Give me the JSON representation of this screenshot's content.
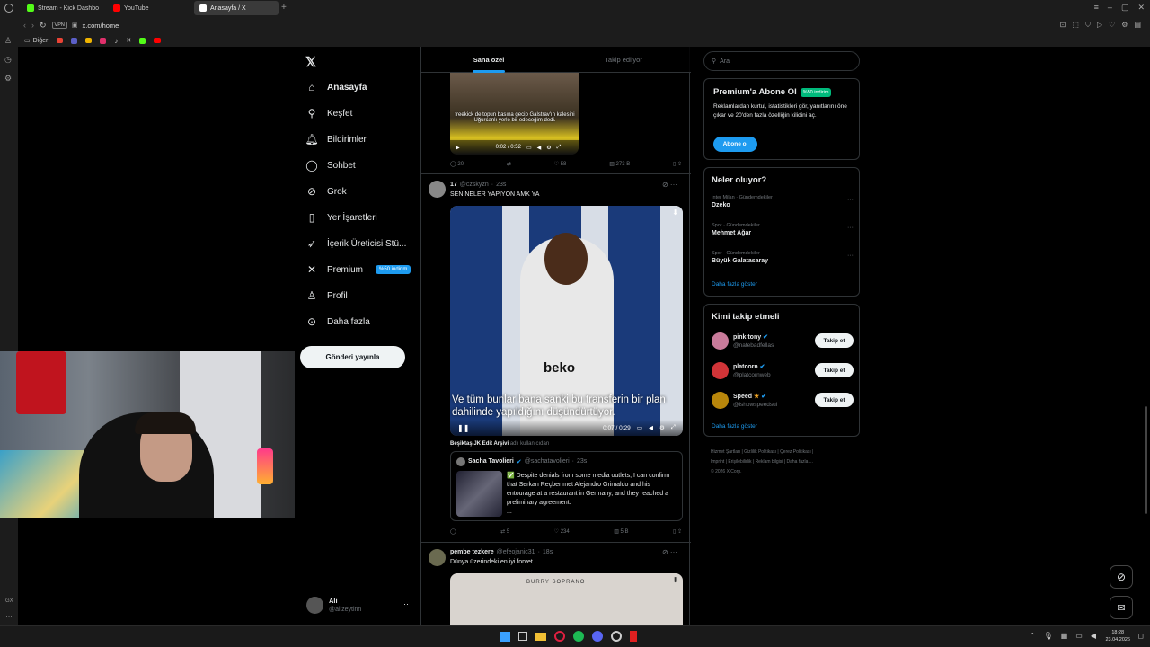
{
  "browser": {
    "tabs": [
      {
        "label": "Stream - Kick Dashbo",
        "color": "#53fc18"
      },
      {
        "label": "YouTube",
        "color": "#ff0000"
      },
      {
        "label": "Anasayfa / X",
        "color": "#ffffff"
      }
    ],
    "url": "x.com/home",
    "vpn_label": "VPN",
    "bookmarks_label": "Diğer"
  },
  "sidebar": {
    "items": [
      {
        "label": "Anasayfa",
        "icon": "home-icon",
        "glyph": "⌂"
      },
      {
        "label": "Keşfet",
        "icon": "search-icon",
        "glyph": "⚲"
      },
      {
        "label": "Bildirimler",
        "icon": "bell-icon",
        "glyph": "♫"
      },
      {
        "label": "Sohbet",
        "icon": "chat-icon",
        "glyph": "◯"
      },
      {
        "label": "Grok",
        "icon": "grok-icon",
        "glyph": "⊘"
      },
      {
        "label": "Yer İşaretleri",
        "icon": "bookmark-icon",
        "glyph": "▯"
      },
      {
        "label": "İçerik Üreticisi Stü...",
        "icon": "rocket-icon",
        "glyph": "➶"
      },
      {
        "label": "Premium",
        "icon": "x-logo-icon",
        "glyph": "✕",
        "badge": "%50 indirim"
      },
      {
        "label": "Profil",
        "icon": "profile-icon",
        "glyph": "♙"
      },
      {
        "label": "Daha fazla",
        "icon": "more-circle-icon",
        "glyph": "⊙"
      }
    ],
    "post_button": "Gönderi yayınla",
    "account": {
      "name": "Ali",
      "handle": "@alizeytinn"
    }
  },
  "feed": {
    "tabs": [
      "Sana özel",
      "Takip edilyor"
    ],
    "post0": {
      "caption": "freekick de topun basına gecip Galstrav'ın kalesini Uğurcanlı yerle bir edeceğim dedi.",
      "time": "0:02 / 0:52",
      "replies": "20",
      "reposts": "",
      "likes": "58",
      "views": "273 B"
    },
    "post1": {
      "name": "17",
      "handle": "@czskyzn",
      "time": "23s",
      "text": "SEN NELER YAPIYON AMK YA",
      "subtitle": "Ve tüm bunlar bana sanki bu transferin bir plan dahilinde yapıldığını düşündürtüyor.",
      "video_time": "0:07 / 0:29",
      "source_name": "Beşiktaş JK Edit Arşivi",
      "source_suffix": "adlı kullanıcıdan",
      "quote": {
        "name": "Sacha Tavolieri",
        "handle": "@sachatavolieri",
        "time": "23s",
        "text": "✅ Despite denials from some media outlets, I can confirm that Serkan Reçber met Alejandro Grimaldo and his entourage at a restaurant in Germany, and they reached a preliminary agreement.",
        "more": "..."
      },
      "replies": "",
      "reposts": "5",
      "likes": "234",
      "views": "5 B"
    },
    "post2": {
      "name": "pembe tezkere",
      "handle": "@efeojanic31",
      "time": "18s",
      "text": "Dünya üzerindeki en iyi forvet..",
      "image_text": "BURRY SOPRANO"
    }
  },
  "right": {
    "search_placeholder": "Ara",
    "premium": {
      "title": "Premium'a Abone Ol",
      "badge": "%50 indirim",
      "desc": "Reklamlardan kurtul, istatistikleri gör, yanıtlarını öne çıkar ve 20'den fazla özelliğin kilidini aç.",
      "button": "Abone ol"
    },
    "trends": {
      "title": "Neler oluyor?",
      "items": [
        {
          "context": "Inter Milan · Gündemdekiler",
          "name": "Dzeko"
        },
        {
          "context": "Spor · Gündemdekiler",
          "name": "Mehmet Ağar"
        },
        {
          "context": "Spor · Gündemdekiler",
          "name": "Büyük Galatasaray"
        }
      ],
      "more": "Daha fazla göster"
    },
    "follow": {
      "title": "Kimi takip etmeli",
      "items": [
        {
          "name": "pink tony",
          "handle": "@natebadfellas",
          "avatar": "#c97b9b"
        },
        {
          "name": "platcorn",
          "handle": "@platcornweb",
          "avatar": "#d13438"
        },
        {
          "name": "Speed",
          "handle": "@ishowspeedsui",
          "avatar": "#b8860b"
        }
      ],
      "button": "Takip et",
      "more": "Daha fazla göster"
    },
    "footer": [
      "Hizmet Şartları",
      "Gizlilik Politikası",
      "Çerez Politikası",
      "Imprint",
      "Erişilebilirlik",
      "Reklam bilgisi",
      "Daha fazla ...",
      "© 2026 X Corp."
    ]
  },
  "taskbar": {
    "time": "18:28",
    "date": "23.04.2026"
  }
}
